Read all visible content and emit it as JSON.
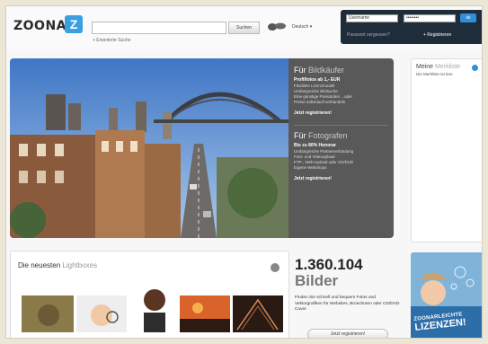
{
  "header": {
    "logo_text": "ZOONAR",
    "logo_mark": "Z",
    "search_button": "Suchen",
    "advanced_search": "+ Erweiterte Suche",
    "language": "Deutsch ▾"
  },
  "login": {
    "username_value": "Username",
    "password_value": "••••••••",
    "ok_label": "ok",
    "forgot_password": "Passwort vergessen?",
    "register": "+ Registrieren"
  },
  "hero": {
    "buyers": {
      "title_plain": "Für",
      "title_accent": "Bildkäufer",
      "strong": "Profilfotos ab 1,- EUR",
      "lines": [
        "Flexibles Lizenzmodell",
        "Umfangreiche Bildsuche",
        "Eine günstige Preisstufen ...oder",
        "Preise individuell verhandeln"
      ],
      "cta": "Jetzt registrieren!"
    },
    "photographers": {
      "title_plain": "Für",
      "title_accent": "Fotografen",
      "strong": "Bis zu 80% Honorar",
      "lines": [
        "Umfangreiche Partnerverbindung",
        "Foto- und Videoupload",
        "FTP-, Web-Upload oder CD/DVD",
        "Eigene Webshops"
      ],
      "cta": "Jetzt registrieren!"
    }
  },
  "sidebar": {
    "title_plain": "Meine",
    "title_accent": "Merkliste",
    "text": "Die Merkliste ist leer."
  },
  "lightboxes": {
    "title_plain": "Die neuesten",
    "title_accent": "Lightboxes"
  },
  "stats": {
    "count": "1.360.104",
    "label": "Bilder",
    "description": "Finden Sie schnell und bequem Fotos und Vektorgrafiken für Websites, Broschüren oder CD/DVD Cover.",
    "register_button": "Jetzt registrieren!"
  },
  "ad": {
    "line1": "ZOONARLEICHTE",
    "line2": "LIZENZEN!"
  },
  "colors": {
    "accent_blue": "#2f8fd8",
    "login_bg": "#1f2d3a",
    "panel_bg": "#595959"
  }
}
